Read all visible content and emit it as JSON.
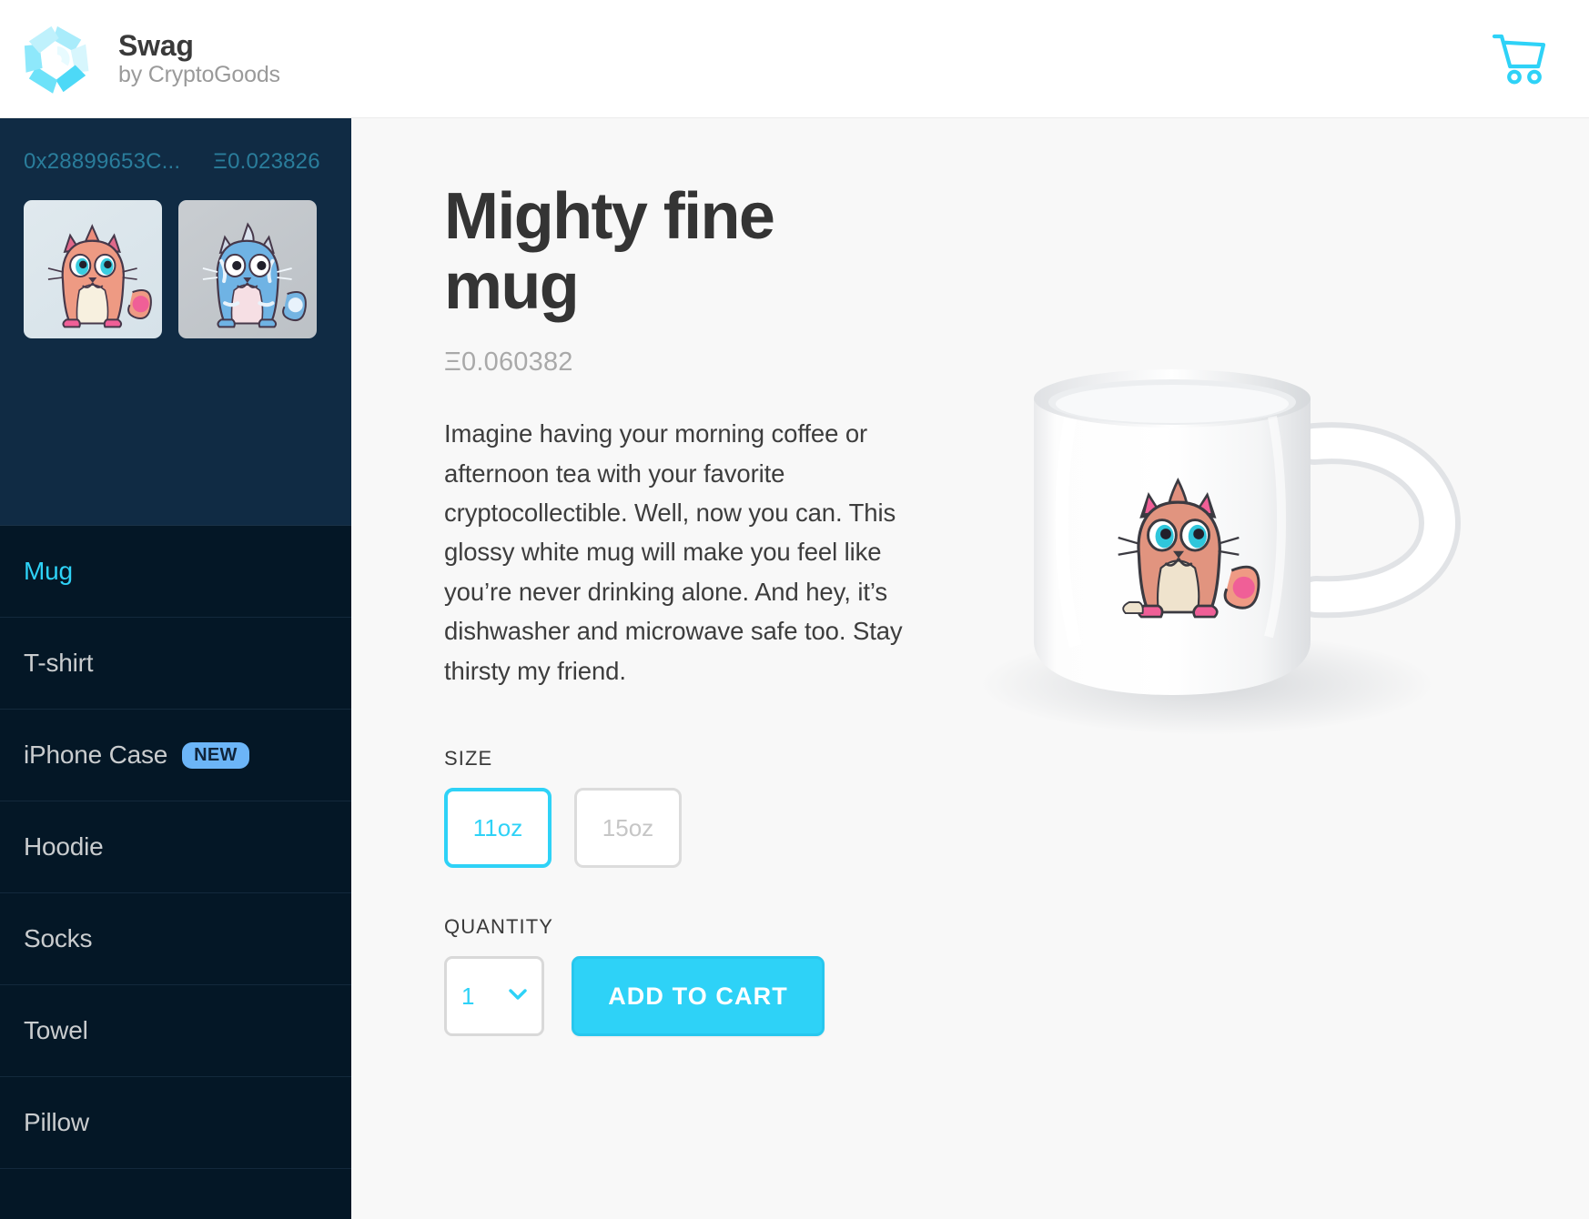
{
  "header": {
    "brand_name": "Swag",
    "brand_sub": "by CryptoGoods",
    "logo_icon": "pinwheel-logo-icon",
    "cart_icon": "shopping-cart-icon",
    "accent_color": "#2ed2f7"
  },
  "sidebar": {
    "wallet": {
      "address": "0x28899653C...",
      "balance": "Φ0.023826",
      "balance_display": "Ξ0.023826"
    },
    "kitties": [
      {
        "name": "salmon-kitty-thumbnail",
        "bg": "#dde7ed"
      },
      {
        "name": "blue-kitty-thumbnail",
        "bg": "#c5c9cd"
      }
    ],
    "nav_items": [
      {
        "label": "Mug",
        "active": true,
        "badge": ""
      },
      {
        "label": "T-shirt",
        "active": false,
        "badge": ""
      },
      {
        "label": "iPhone Case",
        "active": false,
        "badge": "NEW"
      },
      {
        "label": "Hoodie",
        "active": false,
        "badge": ""
      },
      {
        "label": "Socks",
        "active": false,
        "badge": ""
      },
      {
        "label": "Towel",
        "active": false,
        "badge": ""
      },
      {
        "label": "Pillow",
        "active": false,
        "badge": ""
      }
    ]
  },
  "product": {
    "title": "Mighty fine mug",
    "price": "Ξ0.060382",
    "description": "Imagine having your morning coffee or afternoon tea with your favorite cryptocollectible. Well, now you can. This glossy white mug will make you feel like you’re never drinking alone. And hey, it’s dishwasher and microwave safe too. Stay thirsty my friend.",
    "size_label": "SIZE",
    "sizes": [
      {
        "label": "11oz",
        "selected": true
      },
      {
        "label": "15oz",
        "selected": false
      }
    ],
    "quantity_label": "QUANTITY",
    "quantity_value": "1",
    "quantity_chevron_icon": "chevron-down-icon",
    "add_to_cart_label": "ADD TO CART",
    "image_alt": "white-mug-with-cryptokitty"
  }
}
